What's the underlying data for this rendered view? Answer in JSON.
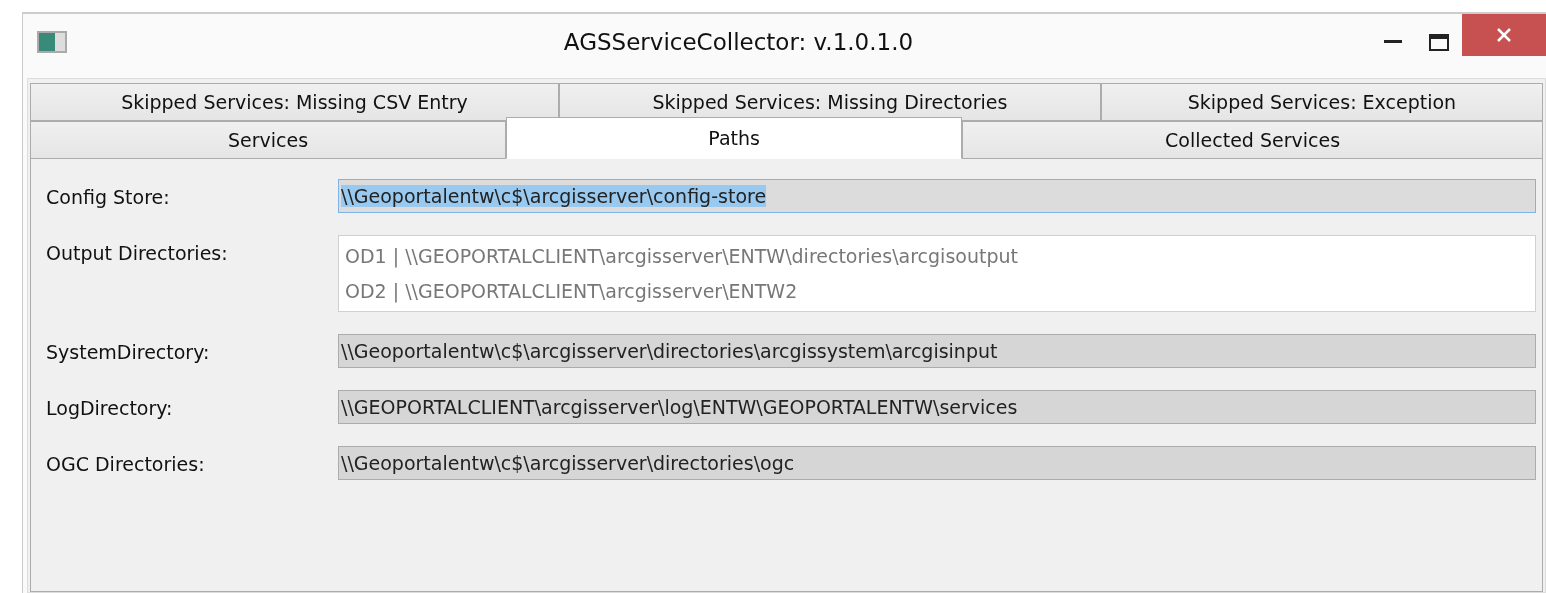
{
  "window": {
    "title": "AGSServiceCollector: v.1.0.1.0"
  },
  "tab_rows": [
    [
      {
        "label": "Skipped Services: Missing CSV Entry",
        "selected": false
      },
      {
        "label": "Skipped Services: Missing Directories",
        "selected": false
      },
      {
        "label": "Skipped Services: Exception",
        "selected": false
      }
    ],
    [
      {
        "label": "Services",
        "selected": false
      },
      {
        "label": "Paths",
        "selected": true
      },
      {
        "label": "Collected Services",
        "selected": false
      }
    ]
  ],
  "fields": [
    {
      "label": "Config Store:",
      "kind": "textbox",
      "value": "\\\\Geoportalentw\\c$\\arcgisserver\\config-store",
      "text_selected": true
    },
    {
      "label": "Output Directories:",
      "kind": "list",
      "items": [
        "OD1 | \\\\GEOPORTALCLIENT\\arcgisserver\\ENTW\\directories\\arcgisoutput",
        "OD2 | \\\\GEOPORTALCLIENT\\arcgisserver\\ENTW2"
      ]
    },
    {
      "label": "SystemDirectory:",
      "kind": "textbox",
      "value": "\\\\Geoportalentw\\c$\\arcgisserver\\directories\\arcgissystem\\arcgisinput",
      "text_selected": false
    },
    {
      "label": "LogDirectory:",
      "kind": "textbox",
      "value": "\\\\GEOPORTALCLIENT\\arcgisserver\\log\\ENTW\\GEOPORTALENTW\\services",
      "text_selected": false
    },
    {
      "label": "OGC Directories:",
      "kind": "textbox",
      "value": "\\\\Geoportalentw\\c$\\arcgisserver\\directories\\ogc",
      "text_selected": false
    }
  ]
}
